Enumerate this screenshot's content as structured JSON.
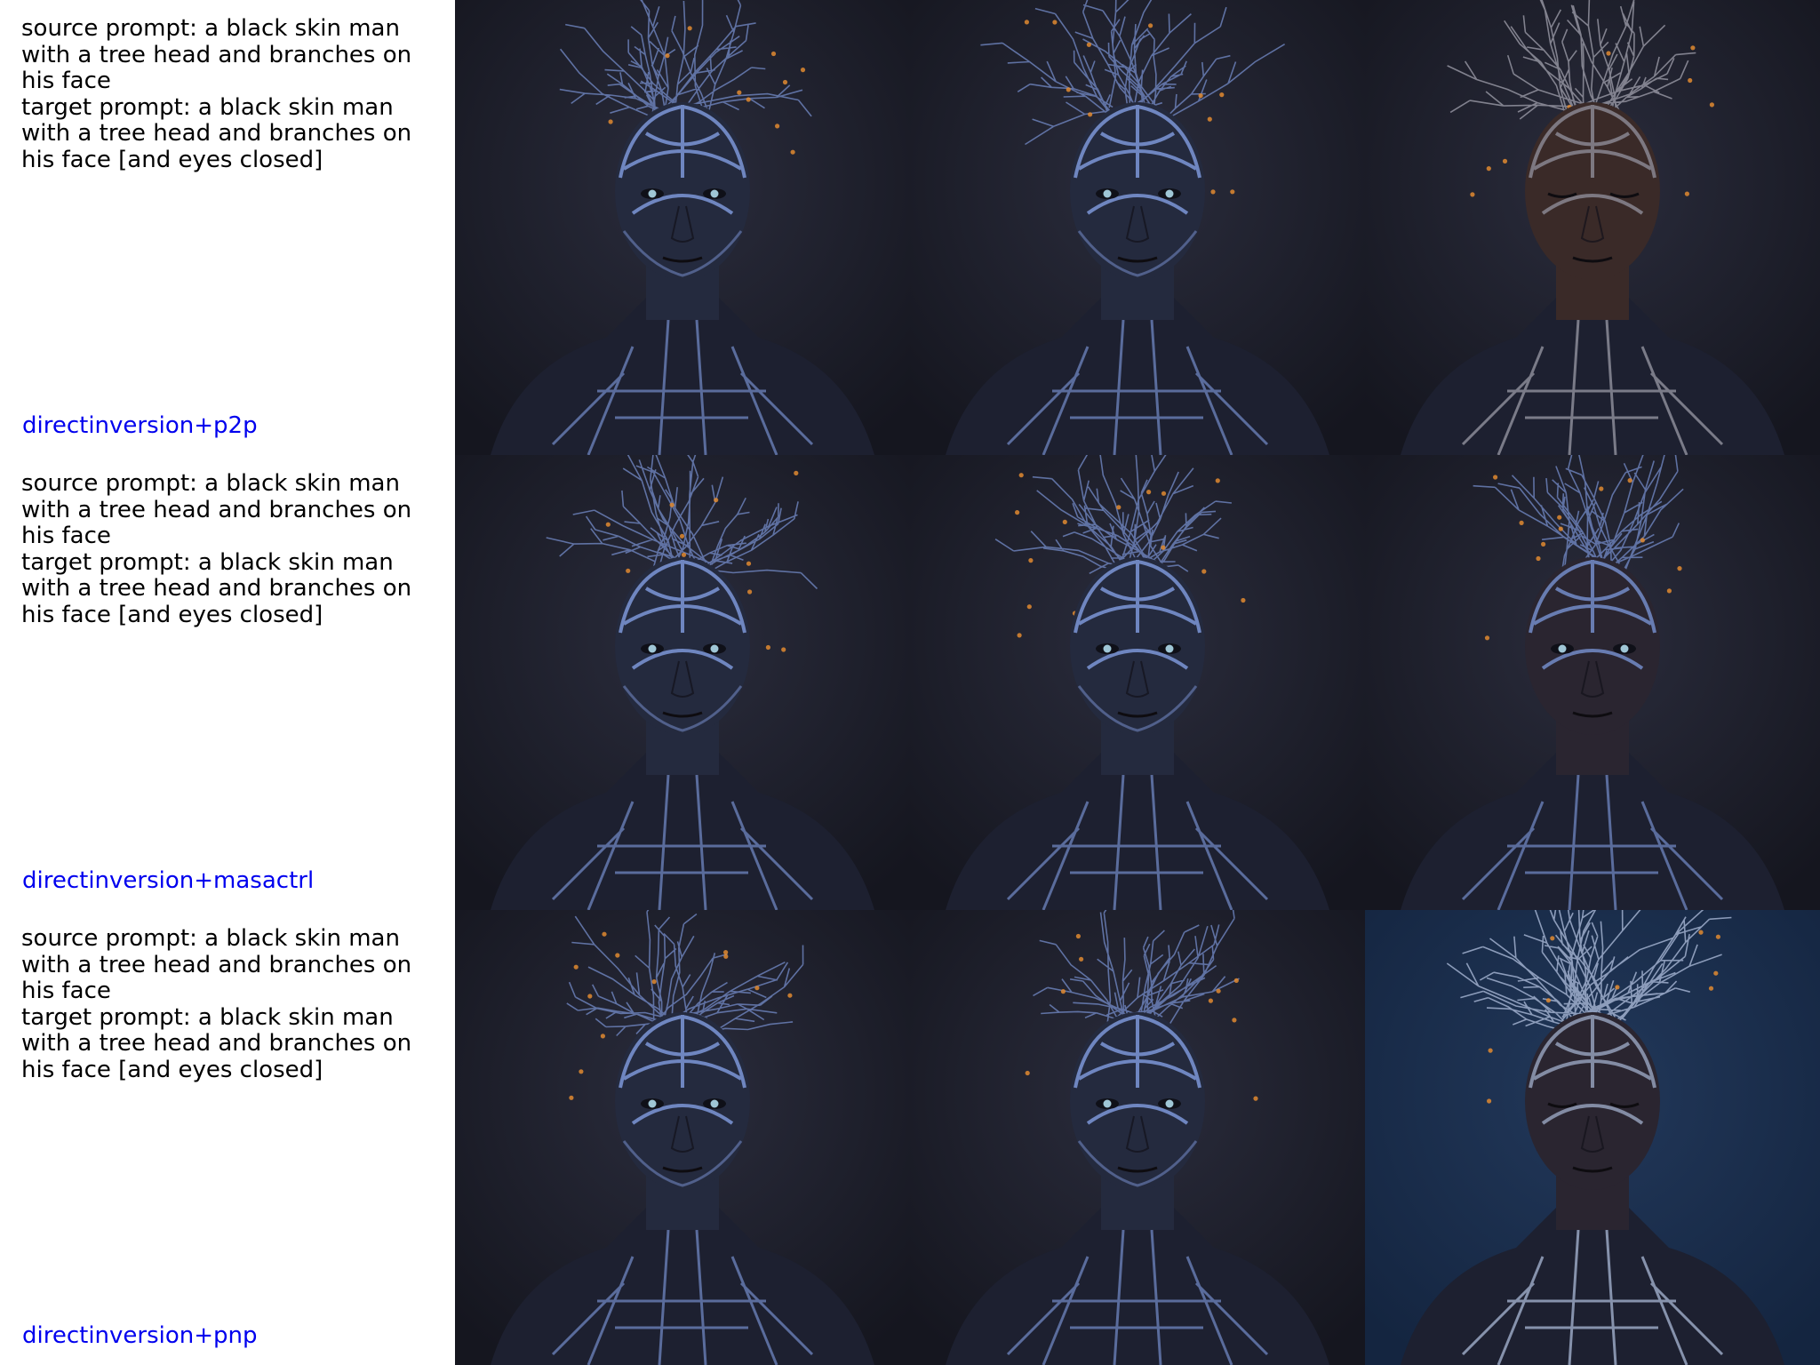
{
  "rows": [
    {
      "source_prompt": "source prompt: a black skin man with a tree head and branches on his face",
      "target_prompt": "target prompt: a black skin man with a tree head and branches on his face [and eyes closed]",
      "method": "directinversion+p2p",
      "images": [
        {
          "name": "source-image",
          "content": "figure with blue branch-vein head and open eyes"
        },
        {
          "name": "reconstruction-image",
          "content": "figure with blue branch-vein head and open eyes"
        },
        {
          "name": "edited-image",
          "content": "dark-skinned man with tangled grey branches, eyes closed"
        }
      ]
    },
    {
      "source_prompt": "source prompt: a black skin man with a tree head and branches on his face",
      "target_prompt": "target prompt: a black skin man with a tree head and branches on his face [and eyes closed]",
      "method": "directinversion+masactrl",
      "images": [
        {
          "name": "source-image",
          "content": "figure with blue branch-vein head and open eyes"
        },
        {
          "name": "reconstruction-image",
          "content": "figure with blue branch-vein head and open eyes"
        },
        {
          "name": "edited-image",
          "content": "dark-skinned man with blue branches, eyes open"
        }
      ]
    },
    {
      "source_prompt": "source prompt: a black skin man with a tree head and branches on his face",
      "target_prompt": "target prompt: a black skin man with a tree head and branches on his face [and eyes closed]",
      "method": "directinversion+pnp",
      "images": [
        {
          "name": "source-image",
          "content": "figure with blue branch-vein head and open eyes"
        },
        {
          "name": "reconstruction-image",
          "content": "figure with blue branch-vein head and open eyes"
        },
        {
          "name": "edited-image",
          "content": "man with dense pale branch crown, eyes closed, deep blue background"
        }
      ]
    }
  ],
  "colors": {
    "prompt_text": "#000000",
    "method_label": "#0000ee",
    "background_dark": "#15161f",
    "branch_blue": "#6f86c0",
    "branch_grey": "#9a9aa6",
    "ember": "#e08a30",
    "skin_dark": "#2a2530",
    "pnp_background": "#142540"
  }
}
